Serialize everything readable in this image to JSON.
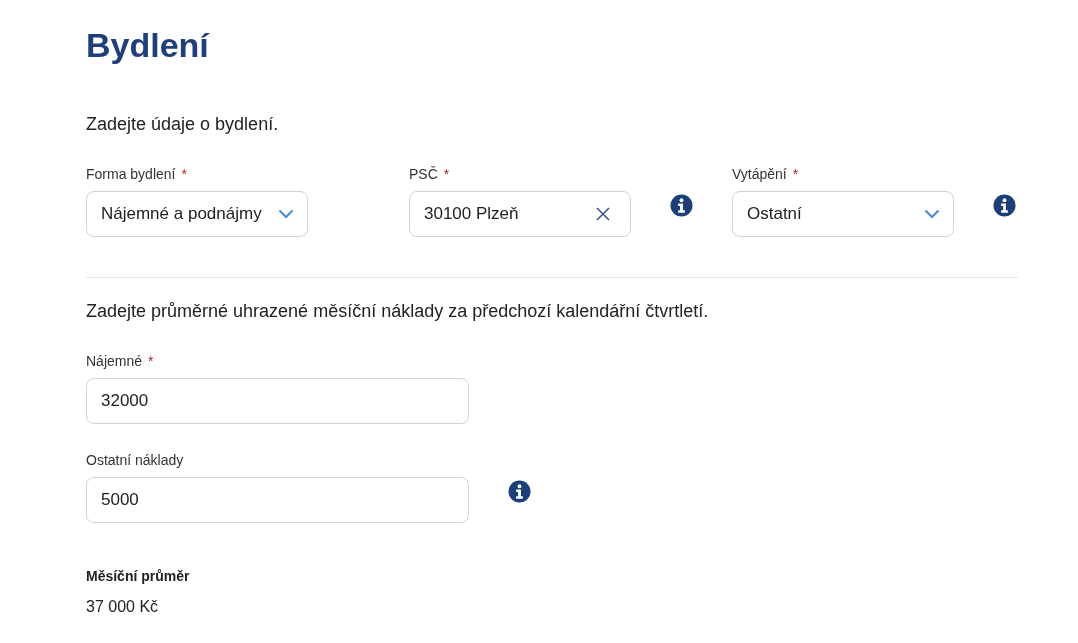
{
  "title": "Bydlení",
  "intro": "Zadejte údaje o bydlení.",
  "housing_fields": [
    {
      "kind": "select",
      "label": "Forma bydlení",
      "required_mark": "*",
      "value": "Nájemné a podnájmy",
      "info": false
    },
    {
      "kind": "clearable",
      "label": "PSČ",
      "required_mark": "*",
      "value": "30100 Plzeň",
      "info": true
    },
    {
      "kind": "select",
      "label": "Vytápění",
      "required_mark": "*",
      "value": "Ostatní",
      "info": true
    }
  ],
  "costs_intro": "Zadejte průměrné uhrazené měsíční náklady za předchozí kalendářní čtvrtletí.",
  "cost_fields": [
    {
      "kind": "input",
      "label": "Nájemné",
      "required_mark": "*",
      "value": "32000",
      "info": false
    },
    {
      "kind": "input",
      "label": "Ostatní náklady",
      "value": "5000",
      "info": true
    }
  ],
  "summary": {
    "label": "Měsíční průměr",
    "value": "37 000 Kč"
  }
}
